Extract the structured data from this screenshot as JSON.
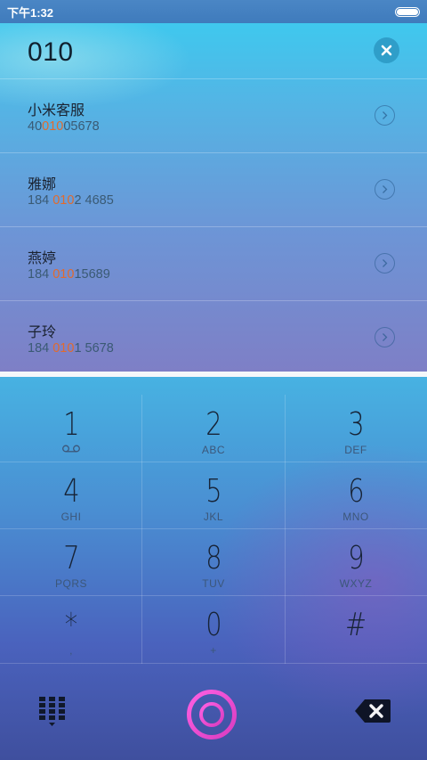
{
  "status_bar": {
    "time": "下午1:32"
  },
  "dialer": {
    "number": "010",
    "results": [
      {
        "name": "小米客服",
        "number_parts": [
          "40",
          "010",
          "05678"
        ]
      },
      {
        "name": "雅娜",
        "number_parts": [
          "184 ",
          "010",
          "2 4685"
        ]
      },
      {
        "name": "燕婷",
        "number_parts": [
          "184 ",
          "010",
          "15689"
        ]
      },
      {
        "name": "子玲",
        "number_parts": [
          "184 ",
          "010",
          "1 5678"
        ]
      }
    ]
  },
  "keypad": {
    "keys": [
      {
        "digit": "1",
        "letters": ""
      },
      {
        "digit": "2",
        "letters": "ABC"
      },
      {
        "digit": "3",
        "letters": "DEF"
      },
      {
        "digit": "4",
        "letters": "GHI"
      },
      {
        "digit": "5",
        "letters": "JKL"
      },
      {
        "digit": "6",
        "letters": "MNO"
      },
      {
        "digit": "7",
        "letters": "PQRS"
      },
      {
        "digit": "8",
        "letters": "TUV"
      },
      {
        "digit": "9",
        "letters": "WXYZ"
      },
      {
        "digit": "*",
        "letters": ","
      },
      {
        "digit": "0",
        "letters": "+"
      },
      {
        "digit": "#",
        "letters": ""
      }
    ]
  },
  "icons": {
    "voicemail": "voicemail-icon",
    "clear": "close-icon",
    "detail": "chevron-right-icon",
    "dialpad": "dialpad-grid-icon",
    "call": "call-ring-icon",
    "backspace": "backspace-icon"
  },
  "colors": {
    "highlight": "#e26a2c",
    "call_ring_start": "#e43fc4",
    "call_ring_end": "#ff5fe0"
  }
}
